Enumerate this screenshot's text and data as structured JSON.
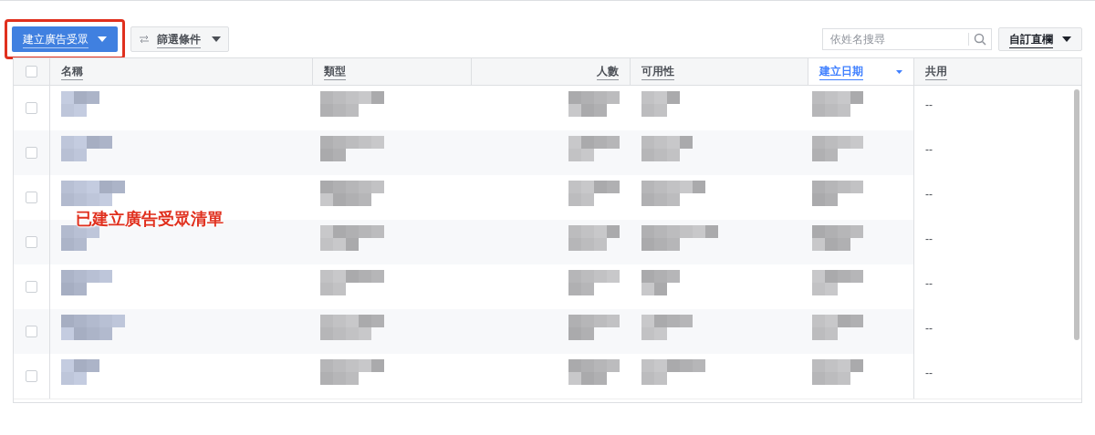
{
  "toolbar": {
    "create_button": {
      "label": "建立廣告受眾",
      "highlighted": true
    },
    "filter_button": {
      "label": "篩選條件"
    },
    "search": {
      "placeholder": "依姓名搜尋"
    },
    "columns_button": {
      "label": "自訂直欄"
    }
  },
  "table": {
    "columns": [
      {
        "label": "名稱",
        "sorted": false
      },
      {
        "label": "類型",
        "sorted": false
      },
      {
        "label": "人數",
        "sorted": false
      },
      {
        "label": "可用性",
        "sorted": false
      },
      {
        "label": "建立日期",
        "sorted": true
      },
      {
        "label": "共用",
        "sorted": false
      }
    ],
    "select_all_checked": false,
    "rows": [
      {
        "checked": false,
        "shared": "--"
      },
      {
        "checked": false,
        "shared": "--"
      },
      {
        "checked": false,
        "shared": "--"
      },
      {
        "checked": false,
        "shared": "--"
      },
      {
        "checked": false,
        "shared": "--"
      },
      {
        "checked": false,
        "shared": "--"
      },
      {
        "checked": false,
        "shared": "--"
      }
    ]
  },
  "annotation": {
    "text": "已建立廣告受眾清單"
  }
}
